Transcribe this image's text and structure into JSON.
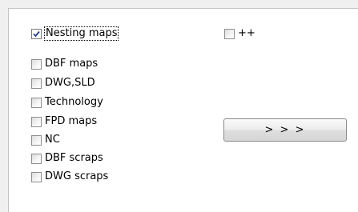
{
  "options": {
    "nesting_maps": {
      "label": "Nesting maps",
      "checked": true
    },
    "plus_plus": {
      "label": "++",
      "checked": false
    },
    "items": [
      {
        "label": "DBF maps",
        "checked": false
      },
      {
        "label": "DWG,SLD",
        "checked": false
      },
      {
        "label": "Technology",
        "checked": false
      },
      {
        "label": "FPD maps",
        "checked": false
      },
      {
        "label": "NC",
        "checked": false
      },
      {
        "label": "DBF scraps",
        "checked": false
      },
      {
        "label": "DWG scraps",
        "checked": false
      }
    ]
  },
  "action_button": {
    "label": "> > >"
  },
  "colors": {
    "check_mark": "#1f3f8c",
    "panel": "#ffffff",
    "background": "#f0f0f0"
  }
}
